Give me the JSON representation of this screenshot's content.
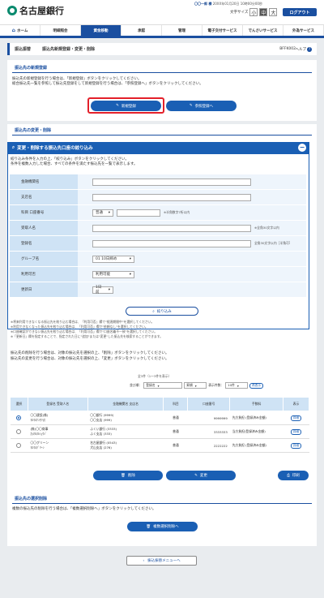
{
  "header": {
    "bank_name": "名古屋銀行",
    "user_name": "〇〇一郎 様",
    "last_login": "20XX年01月20日 10時00分00秒",
    "font_size_label": "文字サイズ",
    "font_size_small": "小",
    "font_size_medium": "中",
    "font_size_large": "大",
    "logout_label": "ログアウト"
  },
  "nav": {
    "items": [
      {
        "label": "ホーム"
      },
      {
        "label": "明細照会"
      },
      {
        "label": "資金移動"
      },
      {
        "label": "承認"
      },
      {
        "label": "管理"
      },
      {
        "label": "電子交付サービス"
      },
      {
        "label": "でんさいサービス"
      },
      {
        "label": "外為サービス"
      }
    ]
  },
  "titlebar": {
    "section": "振込振替",
    "title": "振込先新規登録・変更・削除",
    "code": "BFFK002",
    "help": "ヘルプ",
    "help_mark": "?"
  },
  "new_reg": {
    "heading": "振込先の新規登録",
    "line1": "振込先の新規登録を行う場合は、「新規登録」ボタンをクリックしてください。",
    "line2": "総合振込先一覧を参照して振込先登録をして新規登録を行う場合は、「参照登録へ」ボタンをクリックしてください。",
    "new_btn": "新規登録",
    "ref_btn": "参照登録へ"
  },
  "change": {
    "heading": "振込先の変更・削除",
    "filter_title": "変更・削除する振込先口座の絞り込み",
    "filter_toggle": "−",
    "filter_line1": "絞り込み条件を入力の上、「絞り込み」ボタンをクリックしてください。",
    "filter_line2": "条件を複数入力した場合、すべての条件を満たす振込先を一覧で表示します。",
    "fields": {
      "bank": "金融機関名",
      "branch": "支店名",
      "account": "科目 口座番号",
      "recipient": "受取人名",
      "reg_name": "登録名",
      "group": "グループ名",
      "usable": "利用可否",
      "updated": "更新日"
    },
    "type_value": "普通",
    "account_note": "※半角数字7桁以内",
    "recipient_note": "※全角30文字以内",
    "reg_note": "全角30文字以内［半角可］",
    "group_value": "01 10日締め",
    "usable_value": "利用可能",
    "updated_value": "1日前",
    "filter_btn": "絞り込み",
    "notes": [
      "※将来利用できなくなる振込先を絞り込む場合は、「利用可否」欄で\"経過期間中\"を選択してください。",
      "※利用できなくなった振込先を絞り込む場合は、「利用可否」欄で\"依頼なし\"を選択してください。",
      "※口座確認ができない振込先を絞り込む場合は、「利用可否」欄で\"口座名義不一致\"を選択してください。",
      "※「更新日」欄を指定することで、指定された日に\"追加\"または\"変更\"した振込先を検索することができます。"
    ],
    "delete_instruction": "振込先の削除を行う場合は、対象の振込先を選択の上、「削除」ボタンをクリックしてください。",
    "change_instruction": "振込先の変更を行う場合は、対象の振込先を選択の上、「変更」ボタンをクリックしてください。",
    "result_count": "全3件（1～3件を表示）",
    "sort_label": "並び順：",
    "sort_value": "登録名",
    "order_value": "昇順",
    "per_page_label": "表示件数：",
    "per_page_value": "10件",
    "redisplay": "再表示",
    "columns": [
      "選択",
      "登録名 受取人名",
      "金融機関名 支店名",
      "科目",
      "口座番号",
      "手数料",
      "表示"
    ],
    "rows": [
      {
        "name": "〇〇建設(株)",
        "kana": "ﾏﾙﾏﾙｹﾝｾﾂ(ｶ",
        "bank": "〇〇銀行 (9999)",
        "branch": "〇〇支店 (999)",
        "type": "普通",
        "number": "9999999",
        "fee": "先方負担 (登録済み金額)",
        "detail": "詳細",
        "selected": true
      },
      {
        "name": "(株)〇〇商事",
        "kana": "ｶ)ﾏﾙﾏﾙｼｮｳｼﾞ",
        "bank": "ふくい銀行 (3333)",
        "branch": "ふく支店 (333)",
        "type": "普通",
        "number": "3333333",
        "fee": "当方負担(登録済み金額)",
        "detail": "詳細",
        "selected": false
      },
      {
        "name": "〇〇グリーン",
        "kana": "ﾏﾙﾏﾙｸﾞﾘｰﾝ",
        "bank": "名古屋銀行 (0543)",
        "branch": "犬山支店 (276)",
        "type": "普通",
        "number": "2222222",
        "fee": "先方負担 (登録済み金額)",
        "detail": "詳細",
        "selected": false
      }
    ],
    "delete_btn": "削除",
    "change_btn": "変更",
    "print_btn": "印刷"
  },
  "bulk": {
    "heading": "振込先の選択削除",
    "text": "複数の振込先の削除を行う場合は、「複数選択削除へ」ボタンをクリックしてください。",
    "btn": "複数選択削除へ"
  },
  "back_btn": "振込振替メニューへ"
}
